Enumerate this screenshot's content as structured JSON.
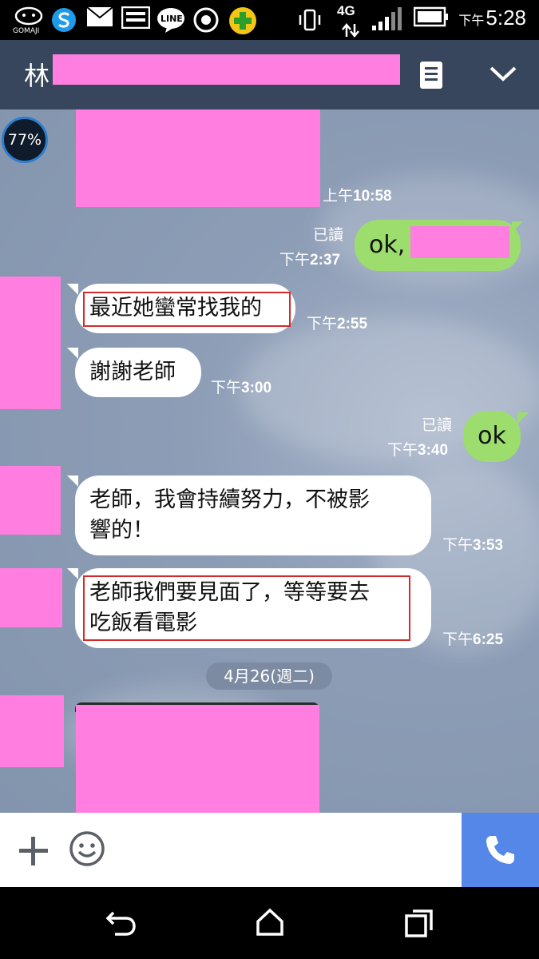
{
  "status_bar": {
    "time_prefix": "下午",
    "time": "5:28",
    "network": "4G",
    "app_icons": [
      "gomaji-icon",
      "s-icon",
      "mail-icon",
      "gallery-icon",
      "line-icon",
      "record-icon",
      "plus-app-icon"
    ],
    "gomaji_label": "GOMAJI",
    "line_label": "LINE"
  },
  "header": {
    "title": "林"
  },
  "chat": {
    "battery_badge": "77%",
    "messages": [
      {
        "side": "left",
        "text": "",
        "time_prefix": "上午",
        "time": "10:58"
      },
      {
        "side": "right",
        "text": "ok,",
        "read": "已讀",
        "time_prefix": "下午",
        "time": "2:37"
      },
      {
        "side": "left",
        "text": "最近她蠻常找我的",
        "time_prefix": "下午",
        "time": "2:55"
      },
      {
        "side": "left",
        "text": "謝謝老師",
        "time_prefix": "下午",
        "time": "3:00"
      },
      {
        "side": "right",
        "text": "ok",
        "read": "已讀",
        "time_prefix": "下午",
        "time": "3:40"
      },
      {
        "side": "left",
        "line1": "老師，我會持續努力，不被影",
        "line2": "響的！",
        "time_prefix": "下午",
        "time": "3:53"
      },
      {
        "side": "left",
        "line1": "老師我們要見面了，等等要去",
        "line2": "吃飯看電影",
        "time_prefix": "下午",
        "time": "6:25"
      }
    ],
    "date_separator": "4月26(週二)"
  },
  "input_bar": {
    "icons": [
      "plus-icon",
      "emoji-icon",
      "phone-icon"
    ]
  },
  "nav_bar": {
    "icons": [
      "back-icon",
      "home-icon",
      "recents-icon"
    ]
  },
  "colors": {
    "header_bg": "#37465c",
    "chat_bg": "#8d9db6",
    "my_bubble": "#9ddd6e",
    "their_bubble": "#ffffff",
    "call_button": "#5587e8",
    "highlight_box": "#d42a2a",
    "privacy_mask": "#ff7ee0"
  }
}
